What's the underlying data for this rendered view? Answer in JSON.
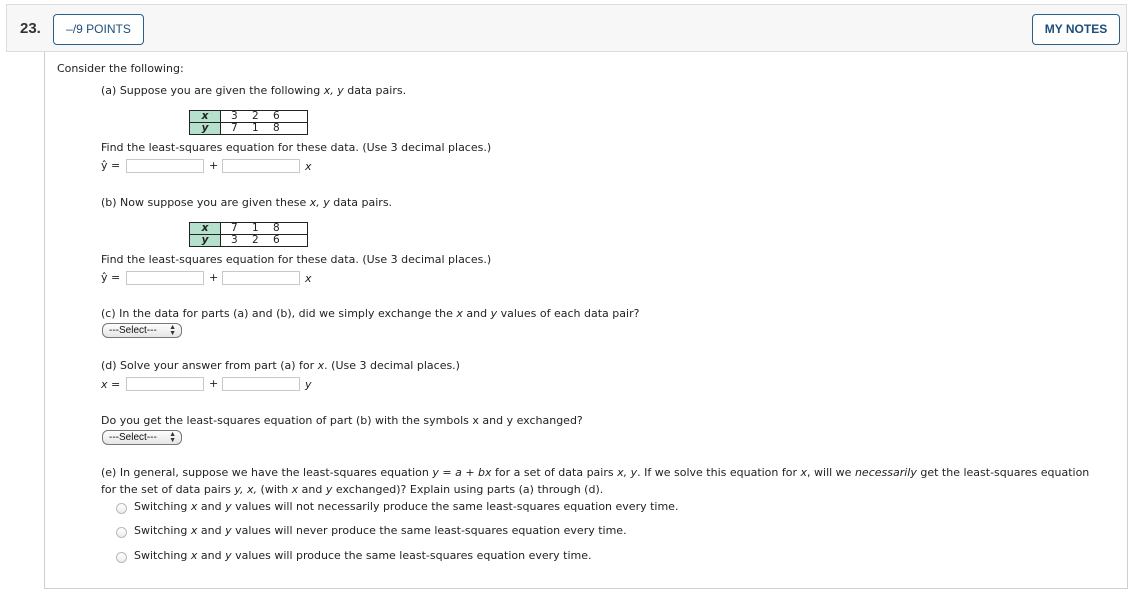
{
  "header": {
    "question_number": "23.",
    "points_label": "–/9 POINTS",
    "notes_label": "MY NOTES"
  },
  "intro": "Consider the following:",
  "part_a": {
    "prompt_pre": "(a) Suppose you are given the following ",
    "prompt_vars": "x, y",
    "prompt_post": " data pairs.",
    "table": {
      "x_label": "x",
      "y_label": "y",
      "x_values": [
        "3",
        "2",
        "6"
      ],
      "y_values": [
        "7",
        "1",
        "8"
      ]
    },
    "instruction": "Find the least-squares equation for these data. (Use 3 decimal places.)",
    "lhs": "ŷ =",
    "plus": "+",
    "var": "x",
    "intercept_value": "",
    "slope_value": ""
  },
  "part_b": {
    "prompt_pre": "(b) Now suppose you are given these ",
    "prompt_vars": "x, y",
    "prompt_post": " data pairs.",
    "table": {
      "x_label": "x",
      "y_label": "y",
      "x_values": [
        "7",
        "1",
        "8"
      ],
      "y_values": [
        "3",
        "2",
        "6"
      ]
    },
    "instruction": "Find the least-squares equation for these data. (Use 3 decimal places.)",
    "lhs": "ŷ =",
    "plus": "+",
    "var": "x",
    "intercept_value": "",
    "slope_value": ""
  },
  "part_c": {
    "prompt_1": "(c) In the data for parts (a) and (b), did we simply exchange the ",
    "var_x": "x",
    "prompt_2": " and ",
    "var_y": "y",
    "prompt_3": " values of each data pair?",
    "select_value": "---Select---"
  },
  "part_d": {
    "prompt_1": "(d) Solve your answer from part (a) for ",
    "var": "x",
    "prompt_2": ". (Use 3 decimal places.)",
    "lhs": "x =",
    "plus": "+",
    "rhs_var": "y",
    "intercept_value": "",
    "slope_value": ""
  },
  "followup": {
    "prompt": "Do you get the least-squares equation of part (b) with the symbols x and y exchanged?",
    "select_value": "---Select---"
  },
  "part_e": {
    "line1_a": "(e) In general, suppose we have the least-squares equation ",
    "line1_eq": "y = a + bx",
    "line1_b": " for a set of data pairs ",
    "line1_vars": "x, y",
    "line1_c": ". If we solve this equation for ",
    "line1_var": "x",
    "line1_d": ", will we ",
    "line1_em": "necessarily",
    "line1_e": " get the least-squares equation",
    "line2_a": "for the set of data pairs ",
    "line2_vars": "y, x,",
    "line2_b": " (with ",
    "line2_x": "x",
    "line2_c": " and ",
    "line2_y": "y",
    "line2_d": " exchanged)? Explain using parts (a) through (d).",
    "options": [
      {
        "pre": "Switching ",
        "x": "x",
        "mid": " and ",
        "y": "y",
        "post": " values will not necessarily produce the same least-squares equation every time.",
        "selected": false
      },
      {
        "pre": "Switching ",
        "x": "x",
        "mid": " and ",
        "y": "y",
        "post": " values will never produce the same least-squares equation every time.",
        "selected": false
      },
      {
        "pre": "Switching ",
        "x": "x",
        "mid": " and ",
        "y": "y",
        "post": " values will produce the same least-squares equation every time.",
        "selected": false
      }
    ]
  }
}
